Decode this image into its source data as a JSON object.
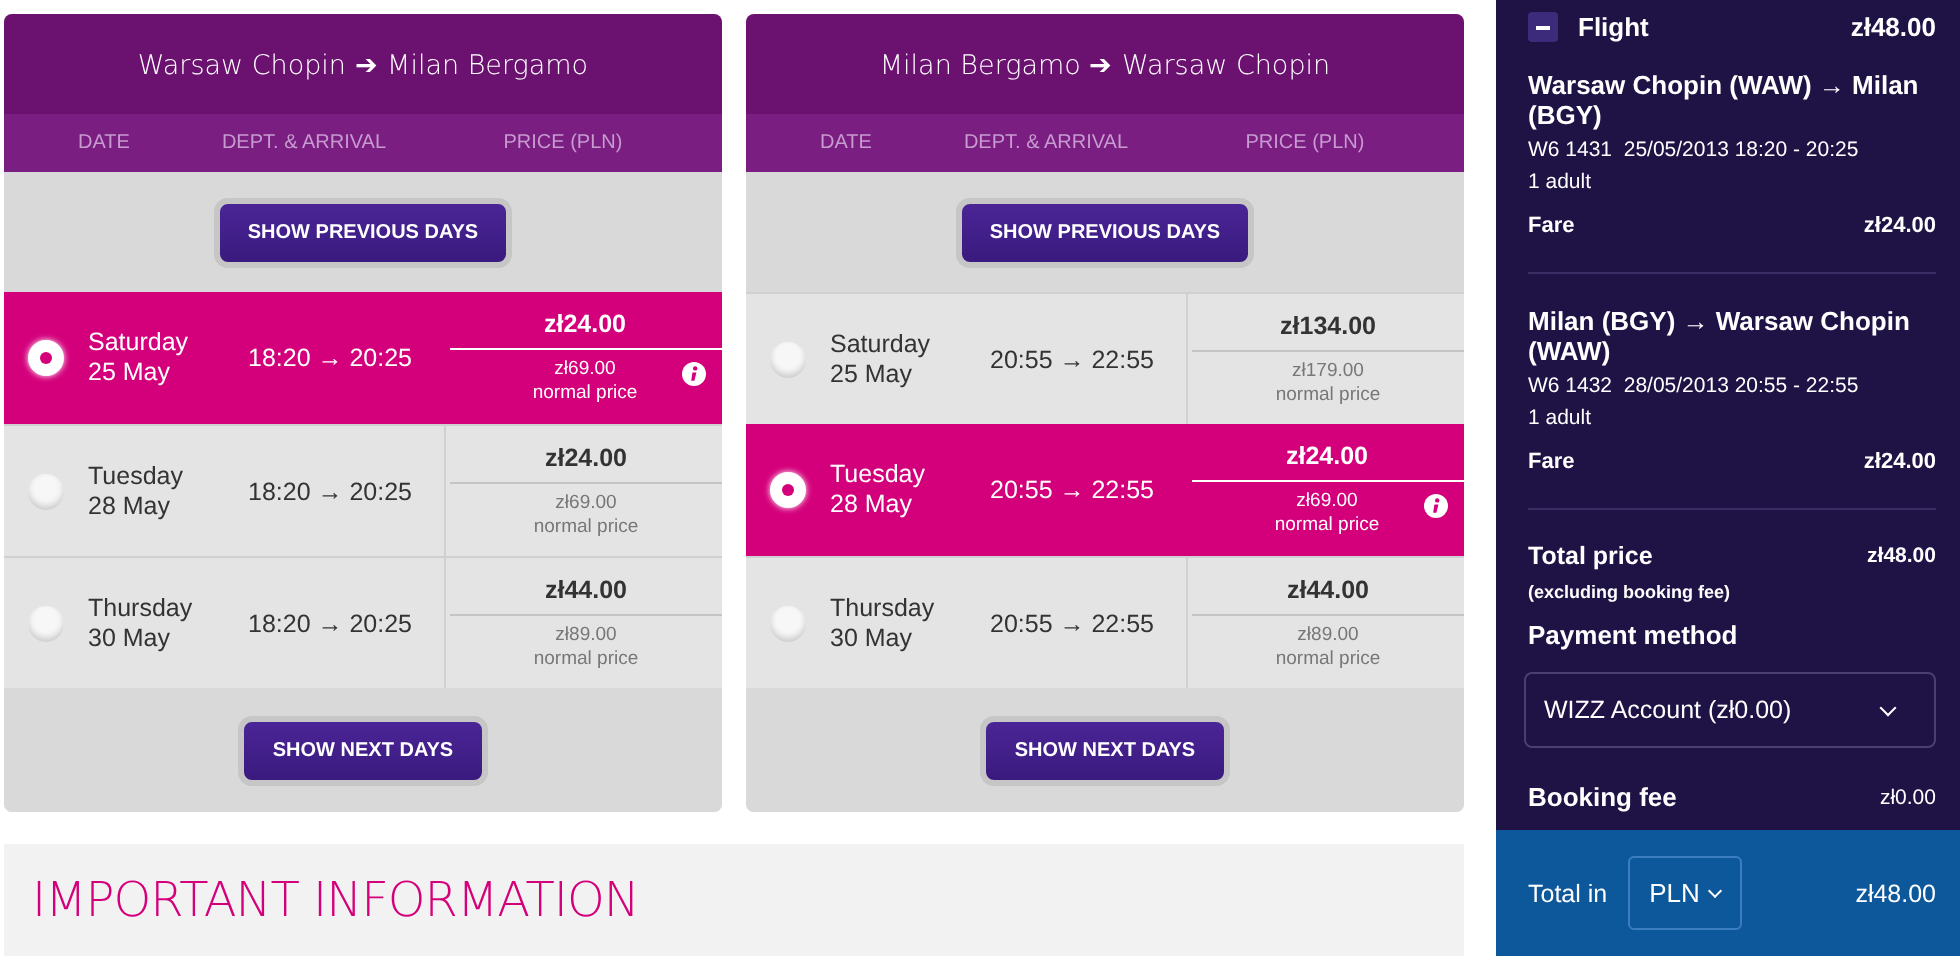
{
  "journeys": [
    {
      "title": "Warsaw Chopin ➔ Milan Bergamo",
      "columns": [
        "DATE",
        "DEPT. & ARRIVAL",
        "PRICE (PLN)"
      ],
      "previous_button": "SHOW PREVIOUS DAYS",
      "next_button": "SHOW NEXT DAYS",
      "flights": [
        {
          "day": "Saturday",
          "date": "25 May",
          "times": "18:20 → 20:25",
          "price": "zł24.00",
          "normal_price": "zł69.00",
          "normal_label": "normal price",
          "selected": true
        },
        {
          "day": "Tuesday",
          "date": "28 May",
          "times": "18:20 → 20:25",
          "price": "zł24.00",
          "normal_price": "zł69.00",
          "normal_label": "normal price",
          "selected": false
        },
        {
          "day": "Thursday",
          "date": "30 May",
          "times": "18:20 → 20:25",
          "price": "zł44.00",
          "normal_price": "zł89.00",
          "normal_label": "normal price",
          "selected": false
        }
      ]
    },
    {
      "title": "Milan Bergamo ➔ Warsaw Chopin",
      "columns": [
        "DATE",
        "DEPT. & ARRIVAL",
        "PRICE (PLN)"
      ],
      "previous_button": "SHOW PREVIOUS DAYS",
      "next_button": "SHOW NEXT DAYS",
      "flights": [
        {
          "day": "Saturday",
          "date": "25 May",
          "times": "20:55 → 22:55",
          "price": "zł134.00",
          "normal_price": "zł179.00",
          "normal_label": "normal price",
          "selected": false
        },
        {
          "day": "Tuesday",
          "date": "28 May",
          "times": "20:55 → 22:55",
          "price": "zł24.00",
          "normal_price": "zł69.00",
          "normal_label": "normal price",
          "selected": true
        },
        {
          "day": "Thursday",
          "date": "30 May",
          "times": "20:55 → 22:55",
          "price": "zł44.00",
          "normal_price": "zł89.00",
          "normal_label": "normal price",
          "selected": false
        }
      ]
    }
  ],
  "important_info": "IMPORTANT INFORMATION",
  "summary": {
    "section": {
      "label": "Flight",
      "amount": "zł48.00"
    },
    "segments": [
      {
        "route": "Warsaw Chopin (WAW) → Milan (BGY)",
        "details": "W6 1431  25/05/2013 18:20 - 20:25",
        "passengers": "1 adult",
        "fare_label": "Fare",
        "fare": "zł24.00"
      },
      {
        "route": "Milan (BGY) → Warsaw Chopin (WAW)",
        "details": "W6 1432  28/05/2013 20:55 - 22:55",
        "passengers": "1 adult",
        "fare_label": "Fare",
        "fare": "zł24.00"
      }
    ],
    "total_label": "Total price",
    "total": "zł48.00",
    "total_note": "(excluding booking fee)",
    "payment_label": "Payment method",
    "payment_method": "WIZZ Account (zł0.00)",
    "booking_fee_label": "Booking fee",
    "booking_fee": "zł0.00",
    "footer": {
      "label": "Total in",
      "currency": "PLN",
      "total": "zł48.00"
    }
  }
}
